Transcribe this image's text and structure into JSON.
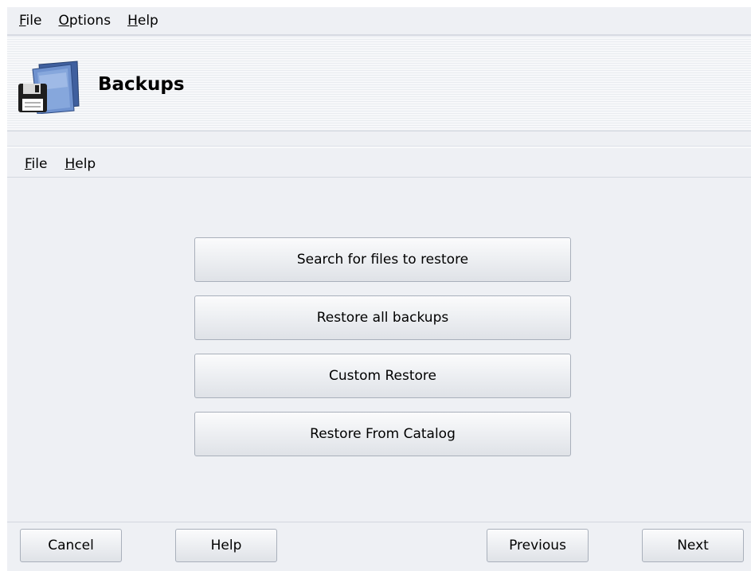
{
  "menubar": {
    "items": [
      {
        "mnemonic": "F",
        "rest": "ile"
      },
      {
        "mnemonic": "O",
        "rest": "ptions"
      },
      {
        "mnemonic": "H",
        "rest": "elp"
      }
    ]
  },
  "header": {
    "title": "Backups",
    "icon": "backup-floppy-folder-icon"
  },
  "inner_menubar": {
    "items": [
      {
        "mnemonic": "F",
        "rest": "ile"
      },
      {
        "mnemonic": "H",
        "rest": "elp"
      }
    ]
  },
  "actions": [
    "Search for files to restore",
    "Restore all backups",
    "Custom Restore",
    "Restore From Catalog"
  ],
  "footer": {
    "cancel": "Cancel",
    "help": "Help",
    "previous": "Previous",
    "next": "Next"
  }
}
